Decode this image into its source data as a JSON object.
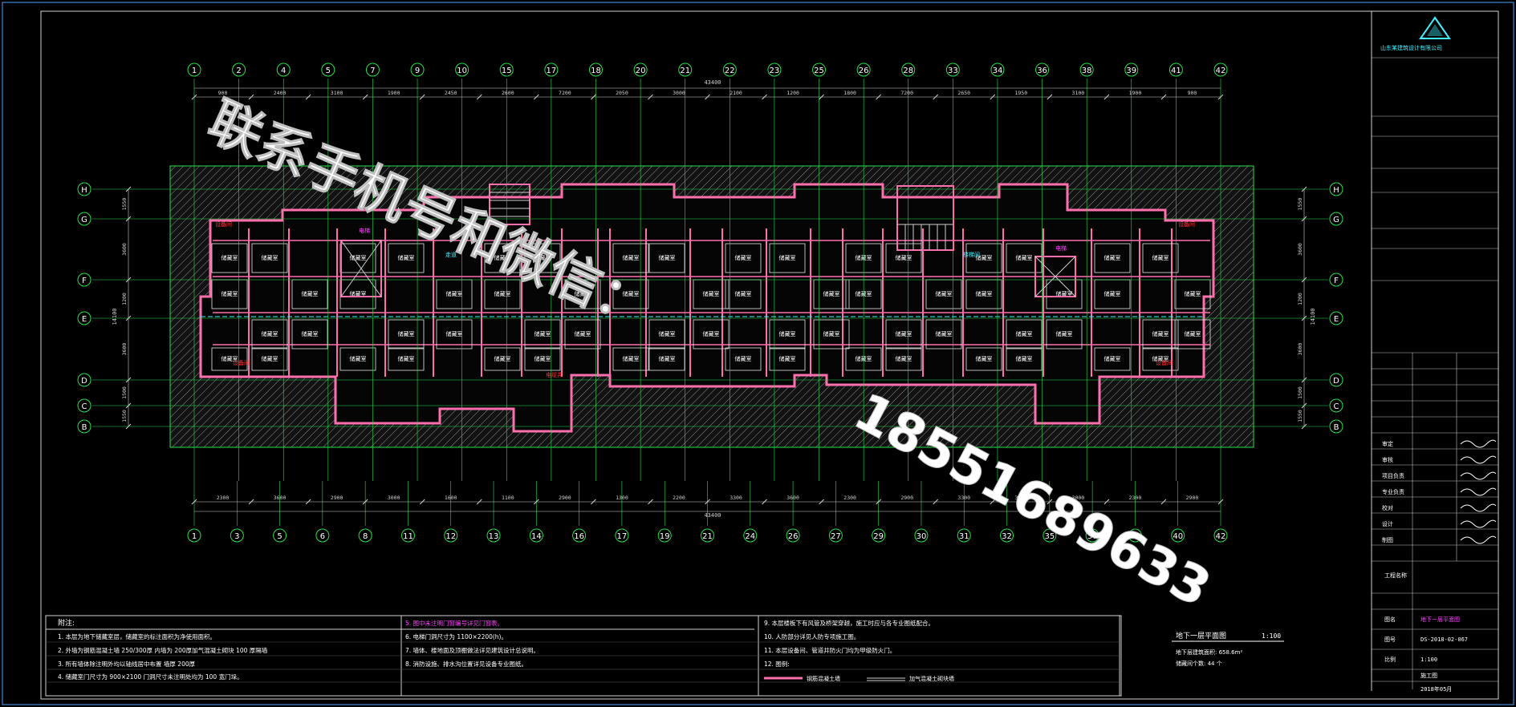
{
  "drawing": {
    "frame_color": "#4aa3ff",
    "grid_color": "#24e04a",
    "wall_color": "#ff6fae",
    "hatch_color": "#9a9a9a",
    "dim_color": "#cfcfcf",
    "label_color": "#ffffff",
    "accent_magenta": "#ff3fff",
    "accent_red": "#ff3030",
    "accent_cyan": "#3ff0ff"
  },
  "grid": {
    "top_axes": [
      "1",
      "2",
      "4",
      "5",
      "7",
      "9",
      "10",
      "15",
      "17",
      "18",
      "20",
      "21",
      "22",
      "23",
      "25",
      "26",
      "28",
      "33",
      "34",
      "36",
      "38",
      "39",
      "41",
      "42"
    ],
    "bottom_axes": [
      "1",
      "3",
      "5",
      "6",
      "8",
      "11",
      "12",
      "13",
      "14",
      "16",
      "17",
      "19",
      "21",
      "24",
      "26",
      "27",
      "29",
      "30",
      "31",
      "32",
      "35",
      "37",
      "38",
      "40",
      "42"
    ],
    "row_axes": [
      "H",
      "G",
      "F",
      "E",
      "D",
      "C",
      "B"
    ],
    "top_dims": [
      "900",
      "2400",
      "3100",
      "1900",
      "2450",
      "2600",
      "7200",
      "2050",
      "3000",
      "2100",
      "1200",
      "1800",
      "7200",
      "2650",
      "1950",
      "3100",
      "1900",
      "900"
    ],
    "overall_top": "43400",
    "bottom_dims": [
      "2300",
      "3600",
      "2900",
      "3000",
      "1600",
      "1100",
      "2900",
      "1300",
      "2200",
      "3300",
      "3600",
      "2300",
      "2900",
      "3300",
      "3600",
      "3000",
      "2300",
      "2900"
    ],
    "overall_bottom": "43400",
    "left_dims": [
      "1550",
      "3600",
      "1200",
      "3600",
      "1500",
      "1550"
    ],
    "left_total": "14100",
    "right_total": "14100"
  },
  "rooms": {
    "storage": "储藏室",
    "equipment": "设备间",
    "corridor": "走道",
    "stair": "楼梯间",
    "elevator": "电梯",
    "shaft": "电缆井"
  },
  "watermark": {
    "line1": "联系手机号和微信：",
    "line2": "18551689633"
  },
  "title_block": {
    "company": "山东某建筑设计有限公司",
    "project_label": "工程名称",
    "drawing_name_label": "图名",
    "drawing_name": "地下一层平面图",
    "drawing_no_label": "图号",
    "drawing_no": "DS-2018-02-067",
    "scale_label": "比例",
    "scale": "1:100",
    "date": "2018年05月",
    "stage": "施工图",
    "rows": [
      "审定",
      "审核",
      "项目负责",
      "专业负责",
      "校对",
      "设计",
      "制图"
    ]
  },
  "notes": {
    "header": "附注:",
    "col1": [
      "1. 本层为地下储藏室层，储藏室的标注面积为净使用面积。",
      "2. 外墙为钢筋混凝土墙 250/300厚 内墙为 200厚加气混凝土砌块 100 厚隔墙",
      "3. 所有墙体除注明外均以轴线居中布置 墙厚 200厚",
      "4. 储藏室门尺寸为 900×2100 门洞尺寸未注明处均为 100 宽门垛。"
    ],
    "col2": [
      "5. 图中未注明门窗编号详见门窗表。",
      "6. 电梯门洞尺寸为 1100×2200(h)。",
      "7. 墙体、楼地面及顶棚做法详见建筑设计总说明。",
      "8. 消防设施、排水沟位置详见设备专业图纸。"
    ],
    "col3": [
      "9. 本层楼板下有风管及桥架穿越，施工时应与各专业图纸配合。",
      "10. 人防部分详见人防专项施工图。",
      "11. 本层设备间、管道井防火门均为甲级防火门。",
      "12. 图例:"
    ],
    "legend": [
      "钢筋混凝土墙",
      "加气混凝土砌块墙"
    ],
    "sheet_title": "地下一层平面图",
    "sheet_scale": "1:100",
    "area_line1": "地下层建筑面积: 658.6m²",
    "area_line2": "储藏间个数: 44 个"
  }
}
